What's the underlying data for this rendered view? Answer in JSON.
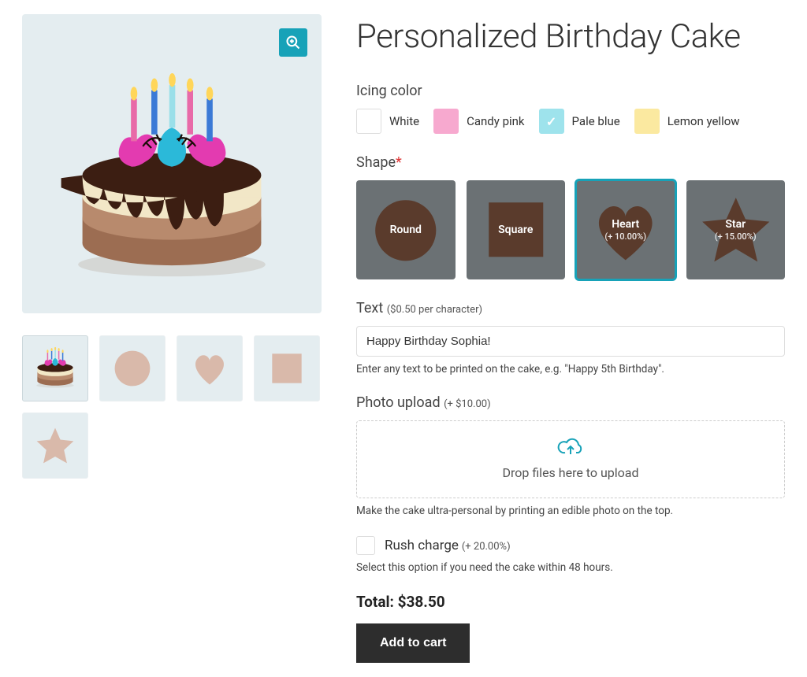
{
  "product": {
    "title": "Personalized Birthday Cake"
  },
  "icing": {
    "label": "Icing color",
    "options": [
      {
        "label": "White",
        "hex": "#ffffff",
        "selected": false
      },
      {
        "label": "Candy pink",
        "hex": "#f7a9cf",
        "selected": false
      },
      {
        "label": "Pale blue",
        "hex": "#9ee3ec",
        "selected": true
      },
      {
        "label": "Lemon yellow",
        "hex": "#fbe9a0",
        "selected": false
      }
    ]
  },
  "shape": {
    "label": "Shape",
    "required": true,
    "options": [
      {
        "name": "Round",
        "surcharge": null,
        "selected": false
      },
      {
        "name": "Square",
        "surcharge": null,
        "selected": false
      },
      {
        "name": "Heart",
        "surcharge": "(+ 10.00%)",
        "selected": true
      },
      {
        "name": "Star",
        "surcharge": "(+ 15.00%)",
        "selected": false
      }
    ]
  },
  "text_field": {
    "label": "Text",
    "price_hint": "($0.50 per character)",
    "value": "Happy Birthday Sophia!",
    "help": "Enter any text to be printed on the cake, e.g. \"Happy 5th Birthday\"."
  },
  "photo": {
    "label": "Photo upload",
    "price_hint": "(+ $10.00)",
    "dropzone_text": "Drop files here to upload",
    "help": "Make the cake ultra-personal by printing an edible photo on the top."
  },
  "rush": {
    "label": "Rush charge",
    "price_hint": "(+ 20.00%)",
    "checked": false,
    "help": "Select this option if you need the cake within 48 hours."
  },
  "total": {
    "label": "Total:",
    "value": "$38.50"
  },
  "cart_button": "Add to cart"
}
